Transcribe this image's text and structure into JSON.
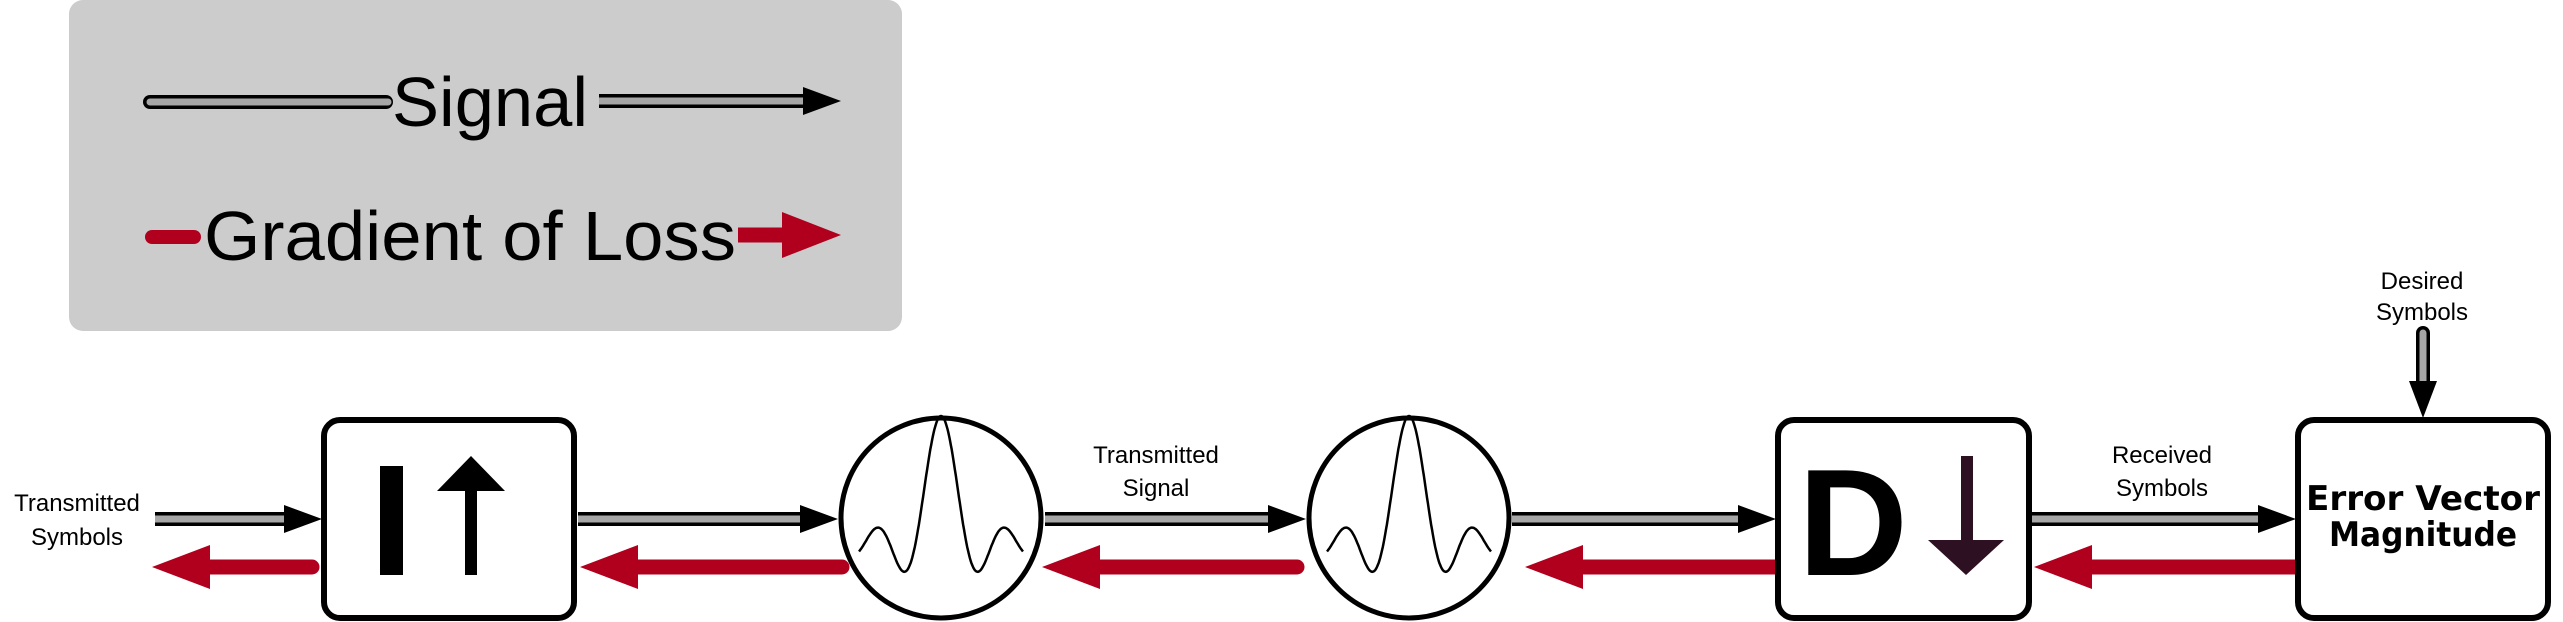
{
  "colors": {
    "signal_fill": "#a6a6a6",
    "signal_outline": "#000000",
    "gradient": "#b0001e",
    "legend_bg": "#cccccc",
    "downsample_arrow": "#2d1022",
    "block_fill": "#ffffff",
    "block_stroke": "#000000"
  },
  "legend": {
    "signal_label": "Signal",
    "gradient_label": "Gradient of Loss"
  },
  "labels": {
    "input_line1": "Transmitted",
    "input_line2": "Symbols",
    "mid_line1": "Transmitted",
    "mid_line2": "Signal",
    "received_line1": "Received",
    "received_line2": "Symbols",
    "desired_line1": "Desired",
    "desired_line2": "Symbols"
  },
  "blocks": {
    "upsample": {
      "glyph": "I",
      "arrow_icon": "up-arrow-icon",
      "meaning": "upsample"
    },
    "tx_filter": {
      "icon": "sinc-pulse-icon"
    },
    "rx_filter": {
      "icon": "sinc-pulse-icon"
    },
    "downsample": {
      "glyph": "D",
      "arrow_icon": "down-arrow-icon",
      "meaning": "downsample"
    },
    "evm": {
      "line1": "Error Vector",
      "line2": "Magnitude"
    }
  }
}
